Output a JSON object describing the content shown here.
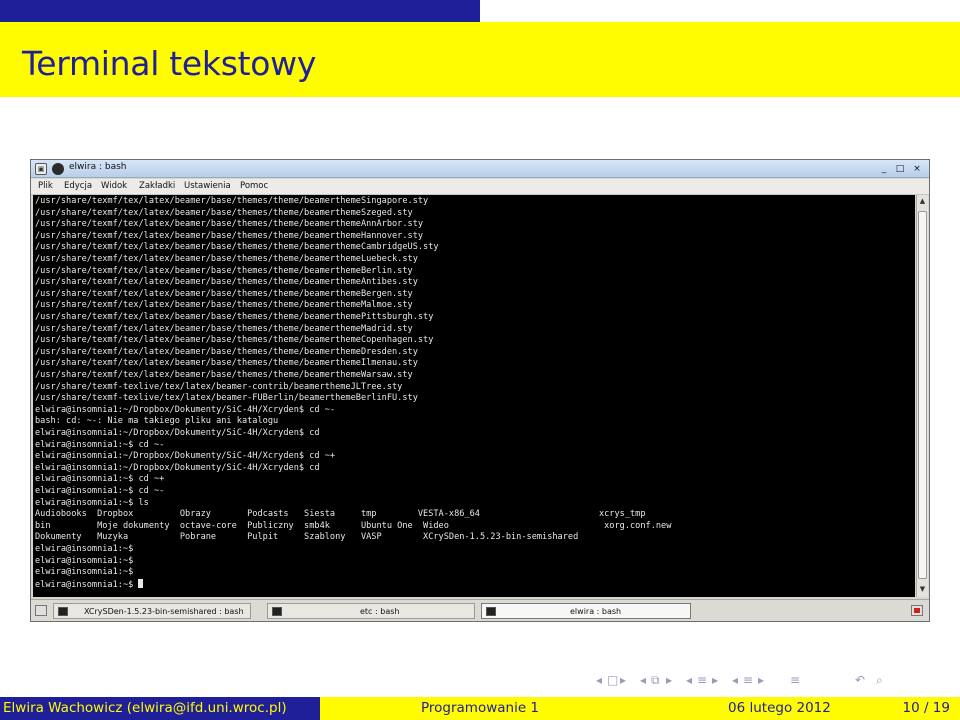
{
  "slide": {
    "title": "Terminal tekstowy",
    "colors": {
      "primary": "#1f1f9a",
      "accent": "#fffb00",
      "terminal_bg": "#000000",
      "terminal_fg": "#e8e8e8"
    }
  },
  "window": {
    "title": "elwira : bash",
    "menu": [
      "Plik",
      "Edycja",
      "Widok",
      "Zakładki",
      "Ustawienia",
      "Pomoc"
    ],
    "controls": [
      "_",
      "□",
      "×"
    ]
  },
  "terminal": {
    "lines": [
      "/usr/share/texmf/tex/latex/beamer/base/themes/theme/beamerthemeSingapore.sty",
      "/usr/share/texmf/tex/latex/beamer/base/themes/theme/beamerthemeSzeged.sty",
      "/usr/share/texmf/tex/latex/beamer/base/themes/theme/beamerthemeAnnArbor.sty",
      "/usr/share/texmf/tex/latex/beamer/base/themes/theme/beamerthemeHannover.sty",
      "/usr/share/texmf/tex/latex/beamer/base/themes/theme/beamerthemeCambridgeUS.sty",
      "/usr/share/texmf/tex/latex/beamer/base/themes/theme/beamerthemeLuebeck.sty",
      "/usr/share/texmf/tex/latex/beamer/base/themes/theme/beamerthemeBerlin.sty",
      "/usr/share/texmf/tex/latex/beamer/base/themes/theme/beamerthemeAntibes.sty",
      "/usr/share/texmf/tex/latex/beamer/base/themes/theme/beamerthemeBergen.sty",
      "/usr/share/texmf/tex/latex/beamer/base/themes/theme/beamerthemeMalmoe.sty",
      "/usr/share/texmf/tex/latex/beamer/base/themes/theme/beamerthemePittsburgh.sty",
      "/usr/share/texmf/tex/latex/beamer/base/themes/theme/beamerthemeMadrid.sty",
      "/usr/share/texmf/tex/latex/beamer/base/themes/theme/beamerthemeCopenhagen.sty",
      "/usr/share/texmf/tex/latex/beamer/base/themes/theme/beamerthemeDresden.sty",
      "/usr/share/texmf/tex/latex/beamer/base/themes/theme/beamerthemeIlmenau.sty",
      "/usr/share/texmf/tex/latex/beamer/base/themes/theme/beamerthemeWarsaw.sty",
      "/usr/share/texmf-texlive/tex/latex/beamer-contrib/beamerthemeJLTree.sty",
      "/usr/share/texmf-texlive/tex/latex/beamer-FUBerlin/beamerthemeBerlinFU.sty",
      "elwira@insomnia1:~/Dropbox/Dokumenty/SiC-4H/Xcryden$ cd ~-",
      "bash: cd: ~-: Nie ma takiego pliku ani katalogu",
      "elwira@insomnia1:~/Dropbox/Dokumenty/SiC-4H/Xcryden$ cd",
      "elwira@insomnia1:~$ cd ~-",
      "elwira@insomnia1:~/Dropbox/Dokumenty/SiC-4H/Xcryden$ cd ~+",
      "elwira@insomnia1:~/Dropbox/Dokumenty/SiC-4H/Xcryden$ cd",
      "elwira@insomnia1:~$ cd ~+",
      "elwira@insomnia1:~$ cd ~-",
      "elwira@insomnia1:~$ ls",
      "Audiobooks  Dropbox         Obrazy       Podcasts   Siesta     tmp        VESTA-x86_64                       xcrys_tmp",
      "bin         Moje dokumenty  octave-core  Publiczny  smb4k      Ubuntu One  Wideo                              xorg.conf.new",
      "Dokumenty   Muzyka          Pobrane      Pulpit     Szablony   VASP        XCrySDen-1.5.23-bin-semishared",
      "elwira@insomnia1:~$",
      "elwira@insomnia1:~$",
      "elwira@insomnia1:~$",
      "elwira@insomnia1:~$ "
    ]
  },
  "taskbar": {
    "tasks": [
      {
        "label": "XCrySDen-1.5.23-bin-semishared : bash",
        "active": false
      },
      {
        "label": "etc : bash",
        "active": false
      },
      {
        "label": "elwira : bash",
        "active": true
      }
    ]
  },
  "footer": {
    "author": "Elwira Wachowicz  (elwira@ifd.uni.wroc.pl)",
    "title": "Programowanie 1",
    "date": "06 lutego 2012",
    "page": "10 / 19"
  }
}
